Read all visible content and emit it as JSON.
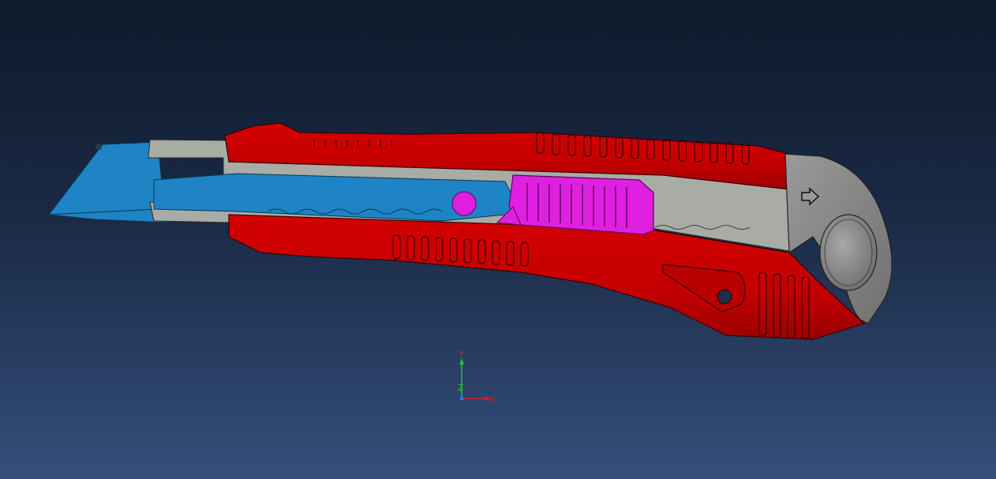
{
  "viewport": {
    "model": "utility-knife",
    "colors": {
      "background_top": "#0f1a2b",
      "background_bottom": "#34507a",
      "body": "#cc0000",
      "blade": "#1e84c6",
      "rail": "#a8aca4",
      "slider": "#e020e0",
      "end_cap": "#8a8a8a"
    }
  },
  "triad": {
    "y_label": "Y",
    "z_label": "Z",
    "x_label": "X",
    "colors": {
      "x": "#d02020",
      "y": "#20c040",
      "z": "#2080e0"
    }
  }
}
